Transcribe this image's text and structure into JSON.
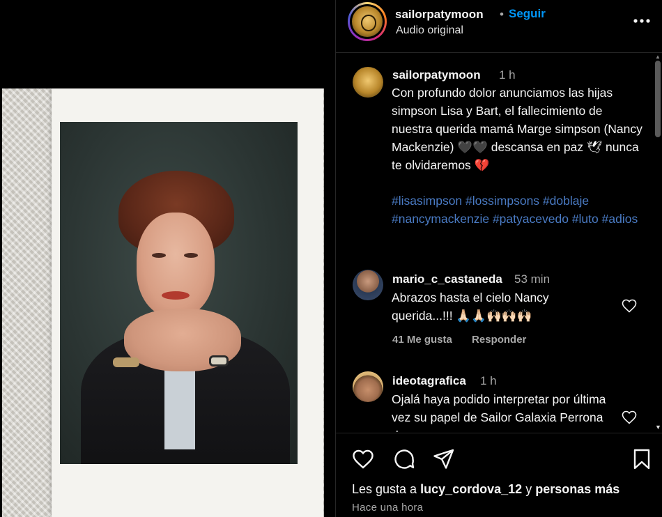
{
  "post": {
    "username": "sailorpatymoon",
    "dot": "•",
    "follow_label": "Seguir",
    "audio": "Audio original",
    "more_icon": "more-horizontal-icon"
  },
  "caption": {
    "username": "sailorpatymoon",
    "time": "1 h",
    "text": "Con profundo dolor anunciamos las hijas simpson Lisa y Bart, el fallecimiento de nuestra querida mamá Marge simpson (Nancy Mackenzie) 🖤🖤 descansa en paz 🕊 nunca te olvidaremos 💔",
    "hashtags": [
      "#lisasimpson",
      "#lossimpsons",
      "#doblaje",
      "#nancymackenzie",
      "#patyacevedo",
      "#luto",
      "#adios"
    ]
  },
  "comments": [
    {
      "username": "mario_c_castaneda",
      "time": "53 min",
      "text": "Abrazos hasta el cielo Nancy querida...!!! 🙏🏻🙏🏻🙌🏻🙌🏻🙌🏻",
      "likes": "41 Me gusta",
      "reply": "Responder"
    },
    {
      "username": "ideotagrafica",
      "time": "1 h",
      "text": "Ojalá haya podido interpretar por última vez su papel de Sailor Galaxia Perrona de..."
    }
  ],
  "footer": {
    "likes_prefix": "Les gusta a",
    "likes_user": "lucy_cordova_12",
    "likes_mid": "y",
    "likes_suffix": "personas más",
    "time_ago": "Hace una hora"
  },
  "colors": {
    "background": "#000000",
    "link_blue": "#0095f6",
    "hashtag": "#4a7bc4",
    "secondary_text": "#a8a8a8"
  }
}
